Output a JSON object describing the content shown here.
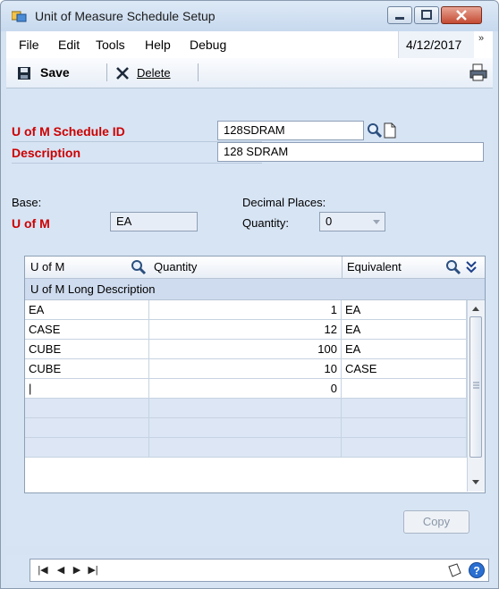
{
  "window": {
    "title": "Unit of Measure Schedule Setup"
  },
  "menu": {
    "items": [
      "File",
      "Edit",
      "Tools",
      "Help",
      "Debug"
    ],
    "date": "4/12/2017"
  },
  "toolbar": {
    "save_label": "Save",
    "delete_label": "Delete"
  },
  "form": {
    "schedule_id_label": "U of M Schedule ID",
    "schedule_id_value": "128SDRAM",
    "description_label": "Description",
    "description_value": "128 SDRAM",
    "base_label": "Base:",
    "uom_label": "U of M",
    "uom_value": "EA",
    "decimal_places_label": "Decimal Places:",
    "quantity_label": "Quantity:",
    "quantity_value": "0"
  },
  "grid": {
    "headers": {
      "uom": "U of M",
      "quantity": "Quantity",
      "equivalent": "Equivalent",
      "long_description": "U of M Long Description"
    },
    "rows": [
      {
        "uom": "EA",
        "quantity": "1",
        "equivalent": "EA"
      },
      {
        "uom": "CASE",
        "quantity": "12",
        "equivalent": "EA"
      },
      {
        "uom": "CUBE",
        "quantity": "100",
        "equivalent": "EA"
      },
      {
        "uom": "CUBE",
        "quantity": "10",
        "equivalent": "CASE"
      },
      {
        "uom": "|",
        "quantity": "0",
        "equivalent": ""
      },
      {
        "uom": "",
        "quantity": "",
        "equivalent": ""
      },
      {
        "uom": "",
        "quantity": "",
        "equivalent": ""
      },
      {
        "uom": "",
        "quantity": "",
        "equivalent": ""
      }
    ]
  },
  "actions": {
    "copy_label": "Copy"
  },
  "colors": {
    "required_label": "#cc0000",
    "window_bg": "#d7e4f4",
    "selected_row": "#dce6f4"
  },
  "icons": [
    "app-icon",
    "minimize-icon",
    "maximize-icon",
    "close-icon",
    "save-icon",
    "delete-icon",
    "print-icon",
    "lookup-icon",
    "new-note-icon",
    "expand-icon",
    "first-record-icon",
    "previous-record-icon",
    "next-record-icon",
    "last-record-icon",
    "note-icon",
    "help-icon"
  ]
}
